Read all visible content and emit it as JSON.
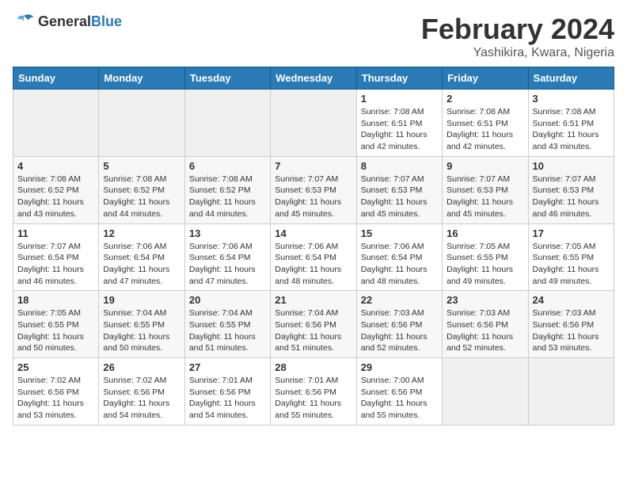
{
  "header": {
    "logo_general": "General",
    "logo_blue": "Blue",
    "month_year": "February 2024",
    "location": "Yashikira, Kwara, Nigeria"
  },
  "weekdays": [
    "Sunday",
    "Monday",
    "Tuesday",
    "Wednesday",
    "Thursday",
    "Friday",
    "Saturday"
  ],
  "weeks": [
    [
      {
        "day": "",
        "info": ""
      },
      {
        "day": "",
        "info": ""
      },
      {
        "day": "",
        "info": ""
      },
      {
        "day": "",
        "info": ""
      },
      {
        "day": "1",
        "info": "Sunrise: 7:08 AM\nSunset: 6:51 PM\nDaylight: 11 hours\nand 42 minutes."
      },
      {
        "day": "2",
        "info": "Sunrise: 7:08 AM\nSunset: 6:51 PM\nDaylight: 11 hours\nand 42 minutes."
      },
      {
        "day": "3",
        "info": "Sunrise: 7:08 AM\nSunset: 6:51 PM\nDaylight: 11 hours\nand 43 minutes."
      }
    ],
    [
      {
        "day": "4",
        "info": "Sunrise: 7:08 AM\nSunset: 6:52 PM\nDaylight: 11 hours\nand 43 minutes."
      },
      {
        "day": "5",
        "info": "Sunrise: 7:08 AM\nSunset: 6:52 PM\nDaylight: 11 hours\nand 44 minutes."
      },
      {
        "day": "6",
        "info": "Sunrise: 7:08 AM\nSunset: 6:52 PM\nDaylight: 11 hours\nand 44 minutes."
      },
      {
        "day": "7",
        "info": "Sunrise: 7:07 AM\nSunset: 6:53 PM\nDaylight: 11 hours\nand 45 minutes."
      },
      {
        "day": "8",
        "info": "Sunrise: 7:07 AM\nSunset: 6:53 PM\nDaylight: 11 hours\nand 45 minutes."
      },
      {
        "day": "9",
        "info": "Sunrise: 7:07 AM\nSunset: 6:53 PM\nDaylight: 11 hours\nand 45 minutes."
      },
      {
        "day": "10",
        "info": "Sunrise: 7:07 AM\nSunset: 6:53 PM\nDaylight: 11 hours\nand 46 minutes."
      }
    ],
    [
      {
        "day": "11",
        "info": "Sunrise: 7:07 AM\nSunset: 6:54 PM\nDaylight: 11 hours\nand 46 minutes."
      },
      {
        "day": "12",
        "info": "Sunrise: 7:06 AM\nSunset: 6:54 PM\nDaylight: 11 hours\nand 47 minutes."
      },
      {
        "day": "13",
        "info": "Sunrise: 7:06 AM\nSunset: 6:54 PM\nDaylight: 11 hours\nand 47 minutes."
      },
      {
        "day": "14",
        "info": "Sunrise: 7:06 AM\nSunset: 6:54 PM\nDaylight: 11 hours\nand 48 minutes."
      },
      {
        "day": "15",
        "info": "Sunrise: 7:06 AM\nSunset: 6:54 PM\nDaylight: 11 hours\nand 48 minutes."
      },
      {
        "day": "16",
        "info": "Sunrise: 7:05 AM\nSunset: 6:55 PM\nDaylight: 11 hours\nand 49 minutes."
      },
      {
        "day": "17",
        "info": "Sunrise: 7:05 AM\nSunset: 6:55 PM\nDaylight: 11 hours\nand 49 minutes."
      }
    ],
    [
      {
        "day": "18",
        "info": "Sunrise: 7:05 AM\nSunset: 6:55 PM\nDaylight: 11 hours\nand 50 minutes."
      },
      {
        "day": "19",
        "info": "Sunrise: 7:04 AM\nSunset: 6:55 PM\nDaylight: 11 hours\nand 50 minutes."
      },
      {
        "day": "20",
        "info": "Sunrise: 7:04 AM\nSunset: 6:55 PM\nDaylight: 11 hours\nand 51 minutes."
      },
      {
        "day": "21",
        "info": "Sunrise: 7:04 AM\nSunset: 6:56 PM\nDaylight: 11 hours\nand 51 minutes."
      },
      {
        "day": "22",
        "info": "Sunrise: 7:03 AM\nSunset: 6:56 PM\nDaylight: 11 hours\nand 52 minutes."
      },
      {
        "day": "23",
        "info": "Sunrise: 7:03 AM\nSunset: 6:56 PM\nDaylight: 11 hours\nand 52 minutes."
      },
      {
        "day": "24",
        "info": "Sunrise: 7:03 AM\nSunset: 6:56 PM\nDaylight: 11 hours\nand 53 minutes."
      }
    ],
    [
      {
        "day": "25",
        "info": "Sunrise: 7:02 AM\nSunset: 6:56 PM\nDaylight: 11 hours\nand 53 minutes."
      },
      {
        "day": "26",
        "info": "Sunrise: 7:02 AM\nSunset: 6:56 PM\nDaylight: 11 hours\nand 54 minutes."
      },
      {
        "day": "27",
        "info": "Sunrise: 7:01 AM\nSunset: 6:56 PM\nDaylight: 11 hours\nand 54 minutes."
      },
      {
        "day": "28",
        "info": "Sunrise: 7:01 AM\nSunset: 6:56 PM\nDaylight: 11 hours\nand 55 minutes."
      },
      {
        "day": "29",
        "info": "Sunrise: 7:00 AM\nSunset: 6:56 PM\nDaylight: 11 hours\nand 55 minutes."
      },
      {
        "day": "",
        "info": ""
      },
      {
        "day": "",
        "info": ""
      }
    ]
  ]
}
